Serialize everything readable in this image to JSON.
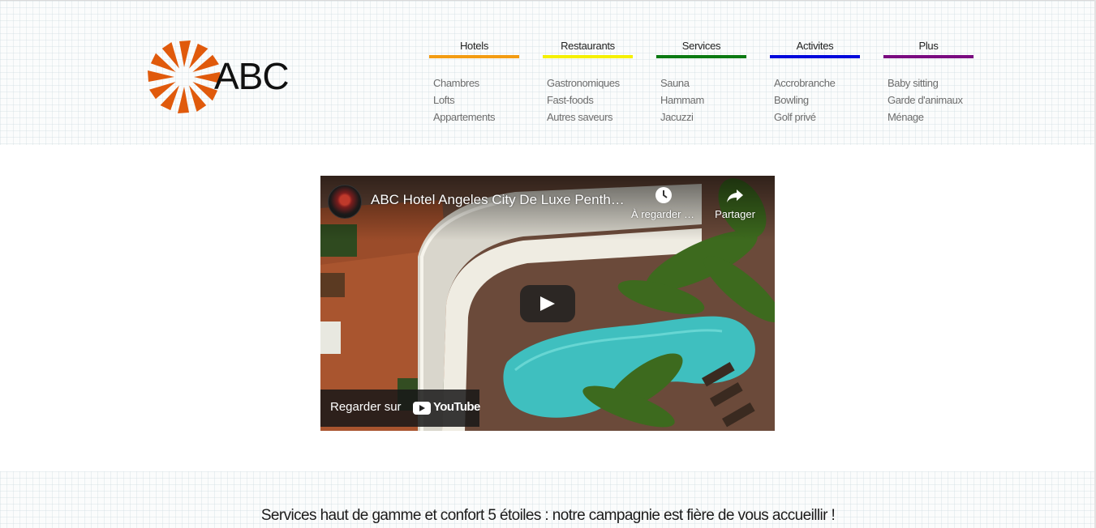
{
  "header": {
    "logo_text": "ABC",
    "logo_color": "#e05a0c"
  },
  "nav": [
    {
      "title": "Hotels",
      "color": "#f39c12",
      "items": [
        "Chambres",
        "Lofts",
        "Appartements"
      ]
    },
    {
      "title": "Restaurants",
      "color": "#f5f000",
      "items": [
        "Gastronomiques",
        "Fast-foods",
        "Autres saveurs"
      ]
    },
    {
      "title": "Services",
      "color": "#0b7a12",
      "items": [
        "Sauna",
        "Hammam",
        "Jacuzzi"
      ]
    },
    {
      "title": "Activites",
      "color": "#0008dc",
      "items": [
        "Accrobranche",
        "Bowling",
        "Golf privé"
      ]
    },
    {
      "title": "Plus",
      "color": "#7a0a80",
      "items": [
        "Baby sitting",
        "Garde d'animaux",
        "Ménage"
      ]
    }
  ],
  "video": {
    "title": "ABC Hotel Angeles City De Luxe Penthouse Suite",
    "watch_later_label": "À regarder plus tard",
    "watch_later_icon": "clock-icon",
    "share_label": "Partager",
    "share_icon": "share-icon",
    "play_icon": "play-icon",
    "watch_on_label": "Regarder sur",
    "youtube_label": "YouTube"
  },
  "tagline": "Services haut de gamme et confort 5 étoiles : notre campagnie est fière de vous accueillir !"
}
